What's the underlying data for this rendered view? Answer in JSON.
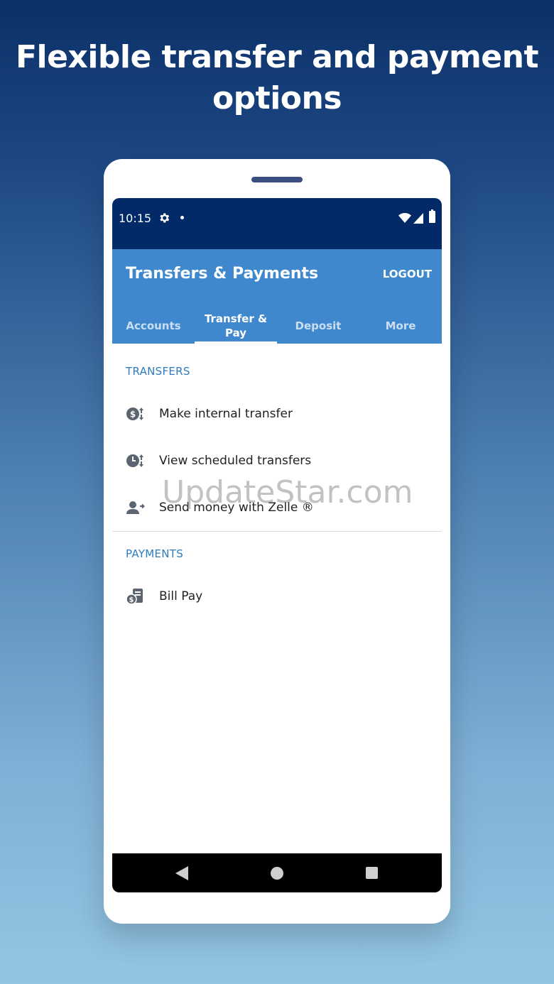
{
  "promo": {
    "title_line1": "Flexible transfer and payment",
    "title_line2": "options"
  },
  "status_bar": {
    "time": "10:15"
  },
  "app_bar": {
    "title": "Transfers & Payments",
    "logout_label": "LOGOUT"
  },
  "tabs": [
    {
      "label": "Accounts",
      "active": false
    },
    {
      "label": "Transfer & Pay",
      "active": true
    },
    {
      "label": "Deposit",
      "active": false
    },
    {
      "label": "More",
      "active": false
    }
  ],
  "sections": {
    "transfers": {
      "header": "TRANSFERS",
      "items": [
        {
          "label": "Make internal transfer",
          "icon": "dollar-transfer-icon"
        },
        {
          "label": "View scheduled transfers",
          "icon": "clock-transfer-icon"
        },
        {
          "label": "Send money with Zelle ®",
          "icon": "person-send-icon"
        }
      ]
    },
    "payments": {
      "header": "PAYMENTS",
      "items": [
        {
          "label": "Bill Pay",
          "icon": "bill-pay-icon"
        }
      ]
    }
  },
  "watermark": "UpdateStar.com",
  "colors": {
    "status_bar": "#022a68",
    "app_bar": "#3f88cd",
    "section_header": "#2d7cc0",
    "icon": "#5b6470"
  }
}
